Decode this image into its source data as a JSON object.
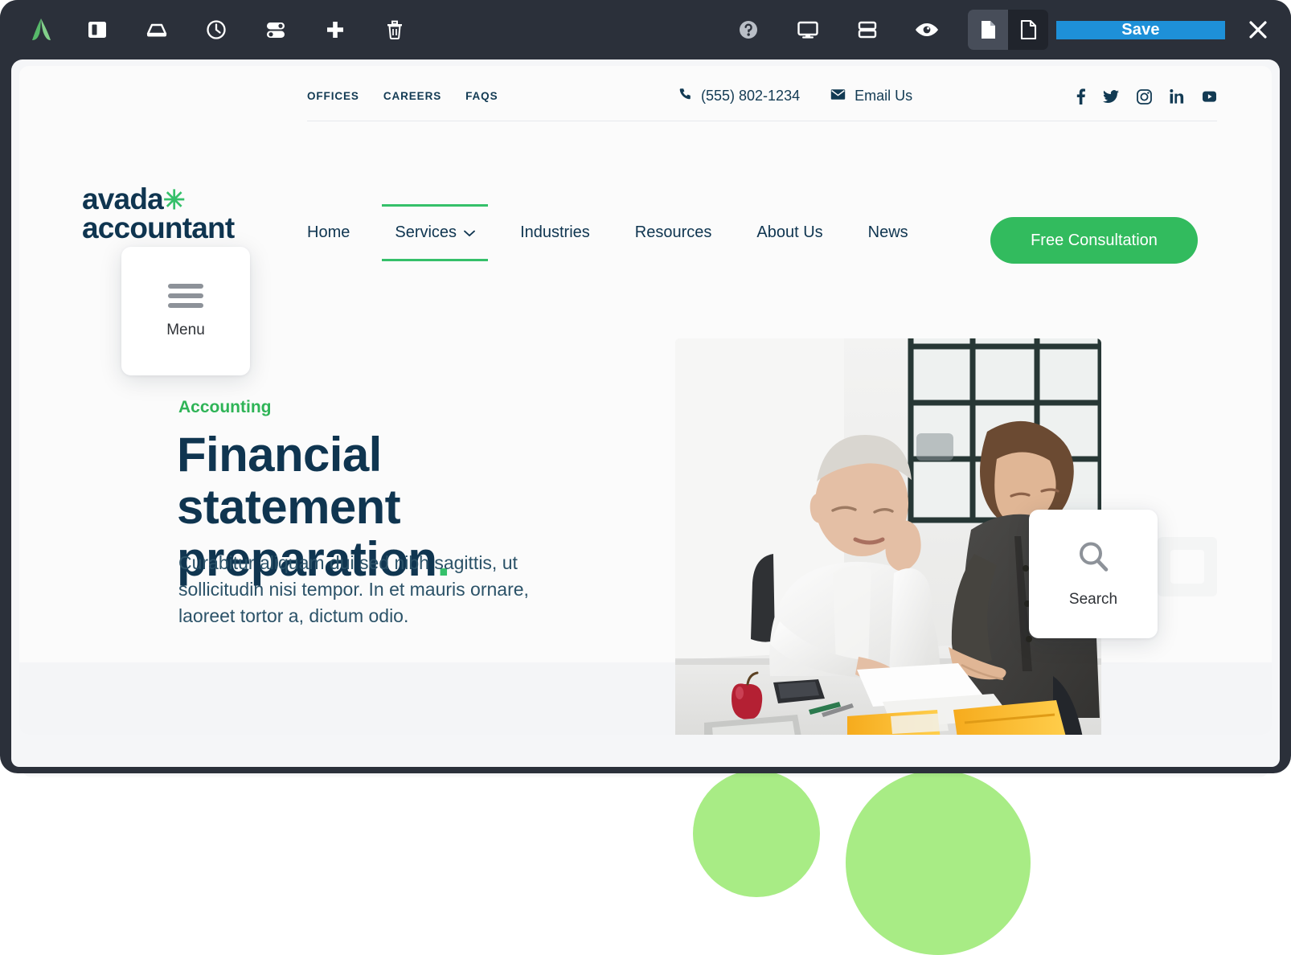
{
  "builder": {
    "toolbar": {
      "left_tools": [
        {
          "name": "avada-logo-icon",
          "label": "Avada"
        },
        {
          "name": "sidebar-panel-icon",
          "label": "Toggle Sidebar"
        },
        {
          "name": "library-icon",
          "label": "Library"
        },
        {
          "name": "history-icon",
          "label": "History"
        },
        {
          "name": "options-icon",
          "label": "Page Options"
        },
        {
          "name": "add-element-icon",
          "label": "Add Element"
        },
        {
          "name": "trash-icon",
          "label": "Delete"
        }
      ],
      "right_tools": [
        {
          "name": "help-icon",
          "label": "Help"
        },
        {
          "name": "responsive-desktop-icon",
          "label": "Desktop View"
        },
        {
          "name": "layout-rows-icon",
          "label": "Layout"
        },
        {
          "name": "preview-eye-icon",
          "label": "Preview"
        }
      ],
      "page_toggle": [
        {
          "name": "page-filled-icon",
          "label": "Page",
          "active": true
        },
        {
          "name": "page-outline-icon",
          "label": "Template",
          "active": false
        }
      ],
      "save_label": "Save",
      "close_label": "✕",
      "save_color": "#1e90d8",
      "bar_color": "#2b303a"
    }
  },
  "site": {
    "logo": {
      "line1": "avada",
      "star": "✳",
      "line2": "accountant"
    },
    "topbar": {
      "links": [
        {
          "label": "OFFICES"
        },
        {
          "label": "CAREERS"
        },
        {
          "label": "FAQS"
        }
      ],
      "phone": "(555) 802-1234",
      "email": "Email Us",
      "socials": [
        {
          "name": "facebook-icon",
          "label": "Facebook"
        },
        {
          "name": "twitter-icon",
          "label": "Twitter"
        },
        {
          "name": "instagram-icon",
          "label": "Instagram"
        },
        {
          "name": "linkedin-icon",
          "label": "LinkedIn"
        },
        {
          "name": "youtube-icon",
          "label": "YouTube"
        }
      ]
    },
    "nav": {
      "items": [
        {
          "label": "Home",
          "active": false,
          "caret": false
        },
        {
          "label": "Services",
          "active": true,
          "caret": true
        },
        {
          "label": "Industries",
          "active": false,
          "caret": false
        },
        {
          "label": "Resources",
          "active": false,
          "caret": false
        },
        {
          "label": "About Us",
          "active": false,
          "caret": false
        },
        {
          "label": "News",
          "active": false,
          "caret": false
        }
      ],
      "cta_label": "Free Consultation",
      "accent_color": "#32bb5e"
    },
    "hero": {
      "eyebrow": "Accounting",
      "title_line1": "Financial statement",
      "title_line2": "preparation",
      "title_dot": ".",
      "paragraph": "Curabitur aliquam dui sed nibh sagittis, ut sollicitudin nisi tempor. In et mauris ornare, laoreet tortor a, dictum odio.",
      "image_alt": "Two men reviewing financial documents at a white office desk"
    }
  },
  "overlays": {
    "menu_card": {
      "icon": "hamburger-icon",
      "label": "Menu"
    },
    "search_card": {
      "icon": "search-icon",
      "label": "Search"
    }
  },
  "decor": {
    "circle_color": "#a8ec85"
  }
}
